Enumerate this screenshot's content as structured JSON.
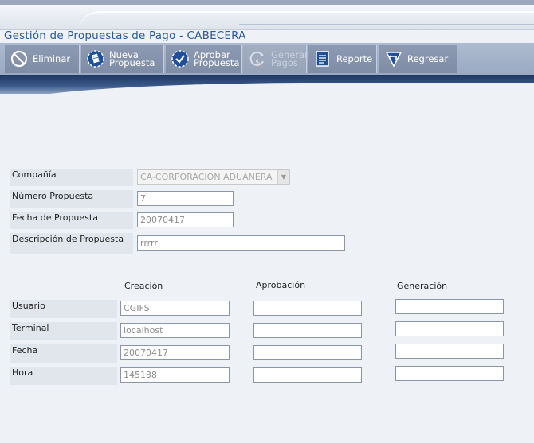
{
  "header": {
    "title": "Gestión de Propuestas de Pago - CABECERA"
  },
  "toolbar": {
    "buttons": [
      {
        "label": "Eliminar",
        "icon": "no-entry-icon",
        "enabled": true
      },
      {
        "label": "Nueva\nPropuesta",
        "icon": "new-document-gear-icon",
        "enabled": true
      },
      {
        "label": "Aprobar\nPropuesta",
        "icon": "approve-gear-icon",
        "enabled": true
      },
      {
        "label": "Generar\nPagos",
        "icon": "dollar-refresh-icon",
        "enabled": false
      },
      {
        "label": "Reporte",
        "icon": "report-icon",
        "enabled": true
      },
      {
        "label": "Regresar",
        "icon": "back-arrow-icon",
        "enabled": true
      }
    ]
  },
  "form": {
    "compania_label": "Compañía",
    "compania_value": "CA-CORPORACION ADUANERA",
    "numero_label": "Número Propuesta",
    "numero_value": "7",
    "fecha_label": "Fecha de Propuesta",
    "fecha_value": "20070417",
    "descripcion_label": "Descripción de Propuesta",
    "descripcion_value": "rrrrr"
  },
  "audit": {
    "columns": [
      "Creación",
      "Aprobación",
      "Generación"
    ],
    "rows": [
      {
        "label": "Usuario",
        "creacion": "CGIFS",
        "aprobacion": "",
        "generacion": ""
      },
      {
        "label": "Terminal",
        "creacion": "localhost",
        "aprobacion": "",
        "generacion": ""
      },
      {
        "label": "Fecha",
        "creacion": "20070417",
        "aprobacion": "",
        "generacion": ""
      },
      {
        "label": "Hora",
        "creacion": "145138",
        "aprobacion": "",
        "generacion": ""
      }
    ]
  }
}
